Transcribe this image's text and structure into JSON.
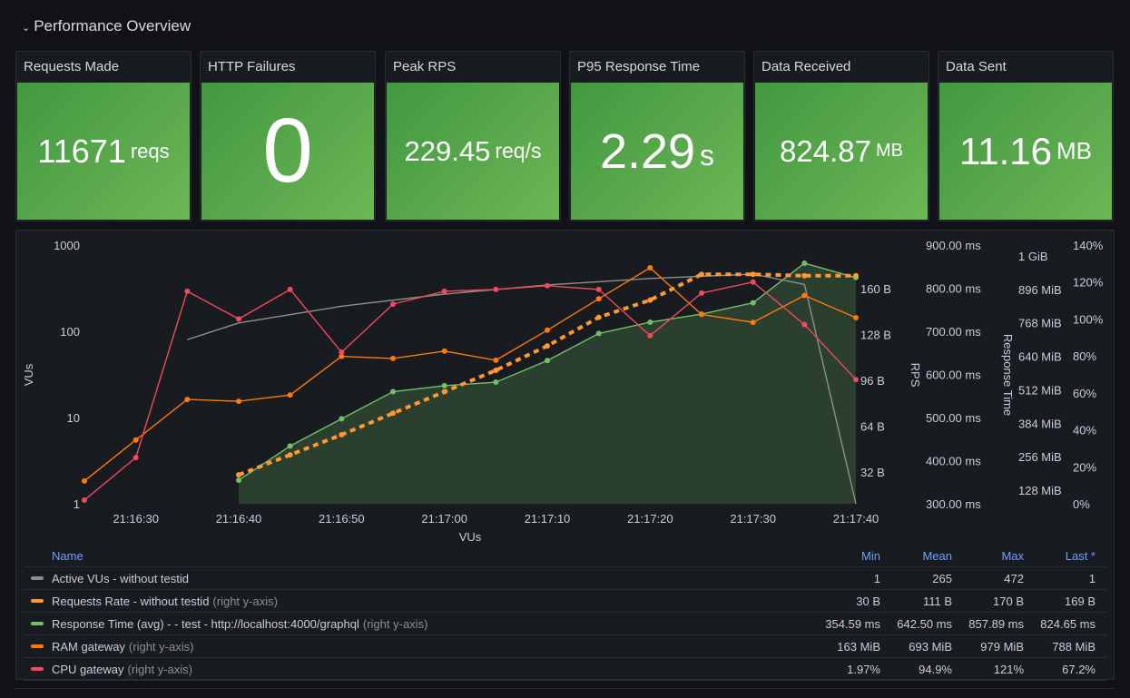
{
  "row": {
    "title": "Performance Overview",
    "chevron_icon": "chevron-down-icon"
  },
  "stats": [
    {
      "title": "Requests Made",
      "value": "11671",
      "unit": "reqs"
    },
    {
      "title": "HTTP Failures",
      "value": "0",
      "unit": ""
    },
    {
      "title": "Peak RPS",
      "value": "229.45",
      "unit": "req/s"
    },
    {
      "title": "P95 Response Time",
      "value": "2.29",
      "unit": "s"
    },
    {
      "title": "Data Received",
      "value": "824.87",
      "unit": "MB"
    },
    {
      "title": "Data Sent",
      "value": "11.16",
      "unit": "MB"
    }
  ],
  "colors": {
    "gray": "#8e8e8e",
    "orange": "#ff9830",
    "orange_dark": "#ff780a",
    "green": "#73bf69",
    "red": "#f2495c",
    "stat_green": "#56a64b",
    "legend_header": "#6e9fff"
  },
  "chart_data": {
    "type": "line",
    "xlabel": "VUs",
    "x_ticks": [
      "21:16:30",
      "21:16:40",
      "21:16:50",
      "21:17:00",
      "21:17:10",
      "21:17:20",
      "21:17:30",
      "21:17:40"
    ],
    "x_range_seconds": [
      -5,
      70
    ],
    "x_origin": "21:16:30",
    "axes": {
      "vus": {
        "label": "VUs",
        "scale": "log",
        "ticks": [
          "1",
          "10",
          "100",
          "1000"
        ],
        "range": [
          1,
          1000
        ]
      },
      "rps": {
        "label": "RPS",
        "ticks": [
          "32 B",
          "64 B",
          "96 B",
          "128 B",
          "160 B"
        ],
        "range": [
          0,
          180
        ]
      },
      "response_time": {
        "label": "Response Time",
        "ticks": [
          "300.00 ms",
          "400.00 ms",
          "500.00 ms",
          "600.00 ms",
          "700.00 ms",
          "800.00 ms",
          "900.00 ms"
        ],
        "range": [
          300,
          900
        ]
      },
      "ram": {
        "ticks": [
          "128 MiB",
          "256 MiB",
          "384 MiB",
          "512 MiB",
          "640 MiB",
          "768 MiB",
          "896 MiB",
          "1 GiB"
        ],
        "range": [
          0,
          1040
        ]
      },
      "cpu": {
        "ticks": [
          "0%",
          "20%",
          "40%",
          "60%",
          "80%",
          "100%",
          "120%",
          "140%"
        ],
        "range": [
          0,
          140
        ]
      }
    },
    "series": [
      {
        "name": "Active VUs - without testid",
        "axis": "vus",
        "color": "#8e8e8e",
        "points": false,
        "dashed": false,
        "x": [
          5,
          10,
          20,
          30,
          40,
          50,
          60,
          65,
          70
        ],
        "y": [
          80,
          125,
          195,
          270,
          345,
          410,
          460,
          350,
          1
        ]
      },
      {
        "name": "Requests Rate - without testid",
        "right_axis": true,
        "axis": "rps",
        "color": "#ff9830",
        "points": true,
        "dashed": true,
        "x": [
          10,
          15,
          20,
          25,
          30,
          35,
          40,
          45,
          50,
          55,
          60,
          65,
          70
        ],
        "y": [
          30,
          44,
          58,
          73,
          88,
          103,
          120,
          140,
          152,
          170,
          170,
          169,
          169
        ]
      },
      {
        "name": "Response Time (avg) - - test - http://localhost:4000/graphql",
        "right_axis": true,
        "axis": "response_time",
        "color": "#73bf69",
        "points": true,
        "dashed": false,
        "fill": true,
        "x": [
          10,
          15,
          20,
          25,
          30,
          35,
          40,
          45,
          50,
          55,
          60,
          65,
          70
        ],
        "y": [
          354.59,
          434,
          497,
          560,
          574,
          582,
          632,
          695,
          721,
          740,
          766,
          857.89,
          824.65
        ]
      },
      {
        "name": "RAM gateway",
        "right_axis": true,
        "axis": "ram",
        "color": "#ff780a",
        "points": true,
        "dashed": false,
        "x": [
          -5,
          0,
          5,
          10,
          15,
          20,
          25,
          30,
          35,
          40,
          45,
          50,
          55,
          60,
          65,
          70
        ],
        "y": [
          163,
          320,
          475,
          468,
          492,
          640,
          632,
          660,
          625,
          740,
          860,
          979,
          800,
          770,
          873,
          788
        ]
      },
      {
        "name": "CPU gateway",
        "right_axis": true,
        "axis": "cpu",
        "color": "#f2495c",
        "points": true,
        "dashed": false,
        "x": [
          -5,
          0,
          5,
          10,
          15,
          20,
          25,
          30,
          35,
          40,
          45,
          50,
          55,
          60,
          65,
          70
        ],
        "y": [
          1.97,
          25,
          115,
          100,
          116,
          82,
          108,
          115,
          116,
          118,
          116,
          91,
          114,
          120,
          97,
          67.2
        ]
      }
    ]
  },
  "legend": {
    "headers": {
      "name": "Name",
      "min": "Min",
      "mean": "Mean",
      "max": "Max",
      "last": "Last *"
    },
    "rows": [
      {
        "name": "Active VUs - without testid",
        "axis_note": "",
        "color": "#8e8e8e",
        "min": "1",
        "mean": "265",
        "max": "472",
        "last": "1"
      },
      {
        "name": "Requests Rate - without testid",
        "axis_note": "(right y-axis)",
        "color": "#ff9830",
        "min": "30 B",
        "mean": "111 B",
        "max": "170 B",
        "last": "169 B"
      },
      {
        "name": "Response Time (avg) - - test - http://localhost:4000/graphql",
        "axis_note": "(right y-axis)",
        "color": "#73bf69",
        "min": "354.59 ms",
        "mean": "642.50 ms",
        "max": "857.89 ms",
        "last": "824.65 ms"
      },
      {
        "name": "RAM gateway",
        "axis_note": "(right y-axis)",
        "color": "#ff780a",
        "min": "163 MiB",
        "mean": "693 MiB",
        "max": "979 MiB",
        "last": "788 MiB"
      },
      {
        "name": "CPU gateway",
        "axis_note": "(right y-axis)",
        "color": "#f2495c",
        "min": "1.97%",
        "mean": "94.9%",
        "max": "121%",
        "last": "67.2%"
      }
    ]
  }
}
